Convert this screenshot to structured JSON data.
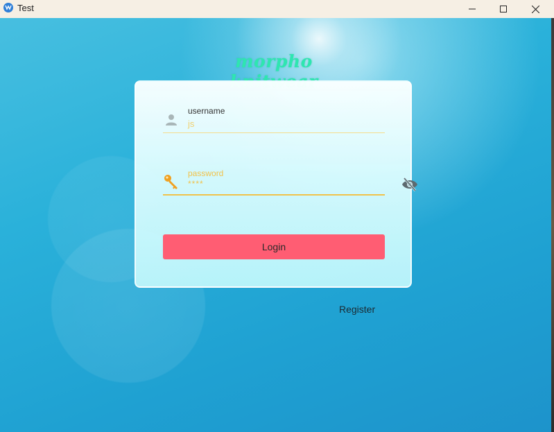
{
  "window": {
    "title": "Test",
    "controls": {
      "minimize": "minimize-icon",
      "maximize": "maximize-icon",
      "close": "close-icon"
    }
  },
  "brand": {
    "text": "morpho knitwear",
    "color": "#2ee6b0"
  },
  "form": {
    "username": {
      "label": "username",
      "value": "js",
      "icon": "person-icon"
    },
    "password": {
      "label": "password",
      "value": "****",
      "icon": "key-icon",
      "visibility_icon": "eye-off-icon"
    },
    "login_label": "Login",
    "register_label": "Register"
  },
  "colors": {
    "accent_yellow": "#f2c24a",
    "login_button": "#ff5d73",
    "background_blue": "#2ab1da"
  }
}
